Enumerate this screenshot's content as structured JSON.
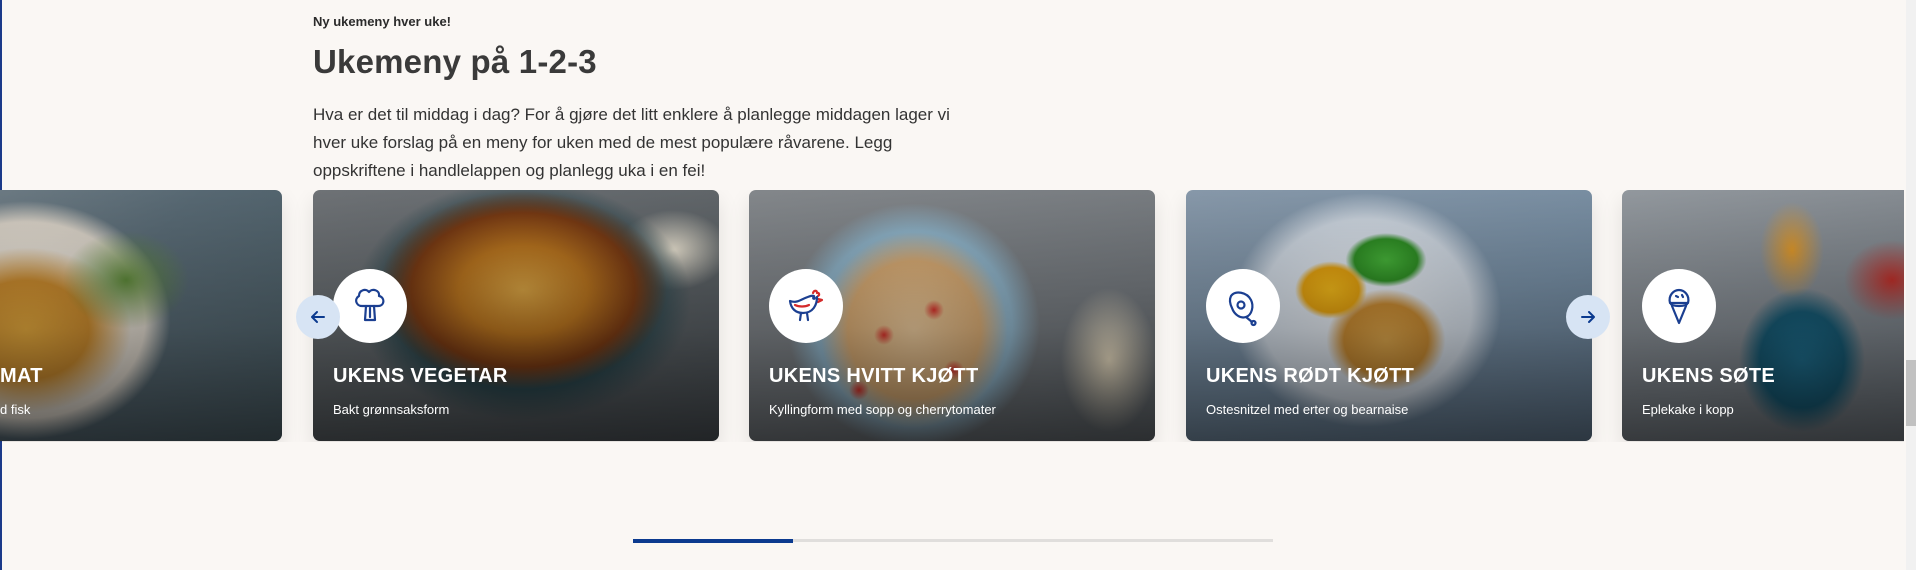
{
  "intro": {
    "eyebrow": "Ny ukemeny hver uke!",
    "title": "Ukemeny på 1-2-3",
    "description": "Hva er det til middag i dag? For å gjøre det litt enklere å planlegge middagen lager vi hver uke forslag på en meny for uken med de mest populære råvarene. Legg oppskriftene i handlelappen og planlegg uka i en fei!"
  },
  "carousel": {
    "cards": [
      {
        "title": "UKENS FISK OG SJØMAT",
        "visible_title": "MAT",
        "subtitle": "d fisk",
        "icon": "fish-icon"
      },
      {
        "title": "UKENS VEGETAR",
        "subtitle": "Bakt grønnsaksform",
        "icon": "broccoli-icon"
      },
      {
        "title": "UKENS HVITT KJØTT",
        "subtitle": "Kyllingform med sopp og cherrytomater",
        "icon": "chicken-icon"
      },
      {
        "title": "UKENS RØDT KJØTT",
        "subtitle": "Ostesnitzel med erter og bearnaise",
        "icon": "meat-leg-icon"
      },
      {
        "title": "UKENS SØTE",
        "subtitle": "Eplekake i kopp",
        "icon": "ice-cream-icon"
      }
    ],
    "prev_icon": "arrow-left-icon",
    "next_icon": "arrow-right-icon",
    "progress": 0.25
  },
  "colors": {
    "background": "#faf7f4",
    "accent": "#0b3a8f",
    "nav_button": "#d7e4f4",
    "icon_blue": "#1b3f91",
    "icon_red": "#d42a2a"
  }
}
